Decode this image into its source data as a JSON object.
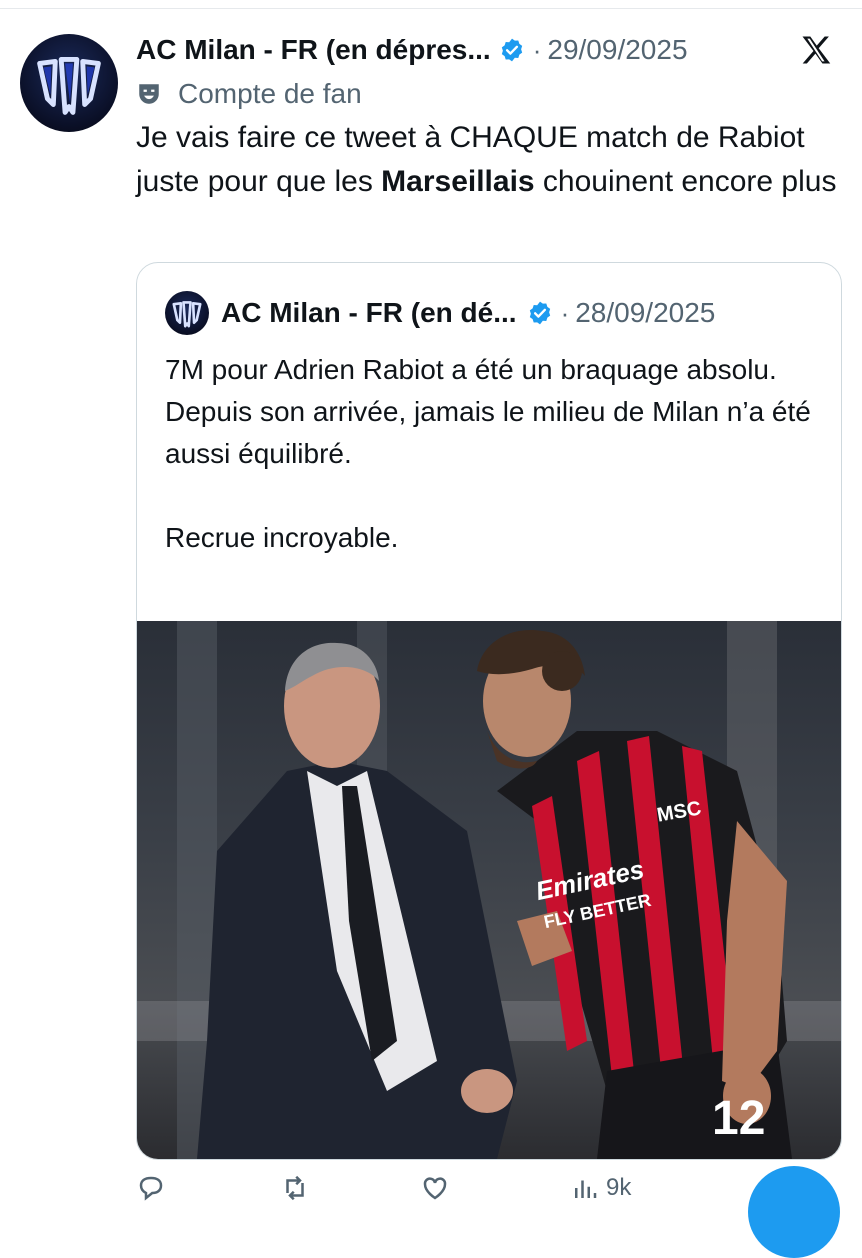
{
  "tweet": {
    "author": "AC Milan - FR (en dépres...",
    "date": "29/09/2025",
    "label": "Compte de fan",
    "text_part1": "Je vais faire ce tweet à CHAQUE match de Rabiot juste pour que les ",
    "text_bold": "Marseillais",
    "text_part2": " chouinent encore plus"
  },
  "quote": {
    "author": "AC Milan - FR (en dé...",
    "date": "28/09/2025",
    "lines": [
      "7M pour Adrien Rabiot a été un braquage absolu.",
      "Depuis son arrivée, jamais le milieu de Milan n’a été aussi équilibré."
    ],
    "last_line": "Recrue incroyable.",
    "photo": {
      "sponsor": "Emirates",
      "slogan": "FLY BETTER",
      "sleeve": "MSC",
      "number": "12"
    }
  },
  "actions": {
    "views": "9k"
  },
  "icons": {
    "verified": "verified-badge-icon",
    "x_logo": "x-logo-icon",
    "fan": "theater-mask-icon",
    "reply": "reply-icon",
    "retweet": "retweet-icon",
    "like": "heart-icon",
    "views": "bar-chart-icon"
  },
  "colors": {
    "accent": "#1d9bf0",
    "secondary_text": "#536471",
    "milan_red": "#c8102e"
  }
}
